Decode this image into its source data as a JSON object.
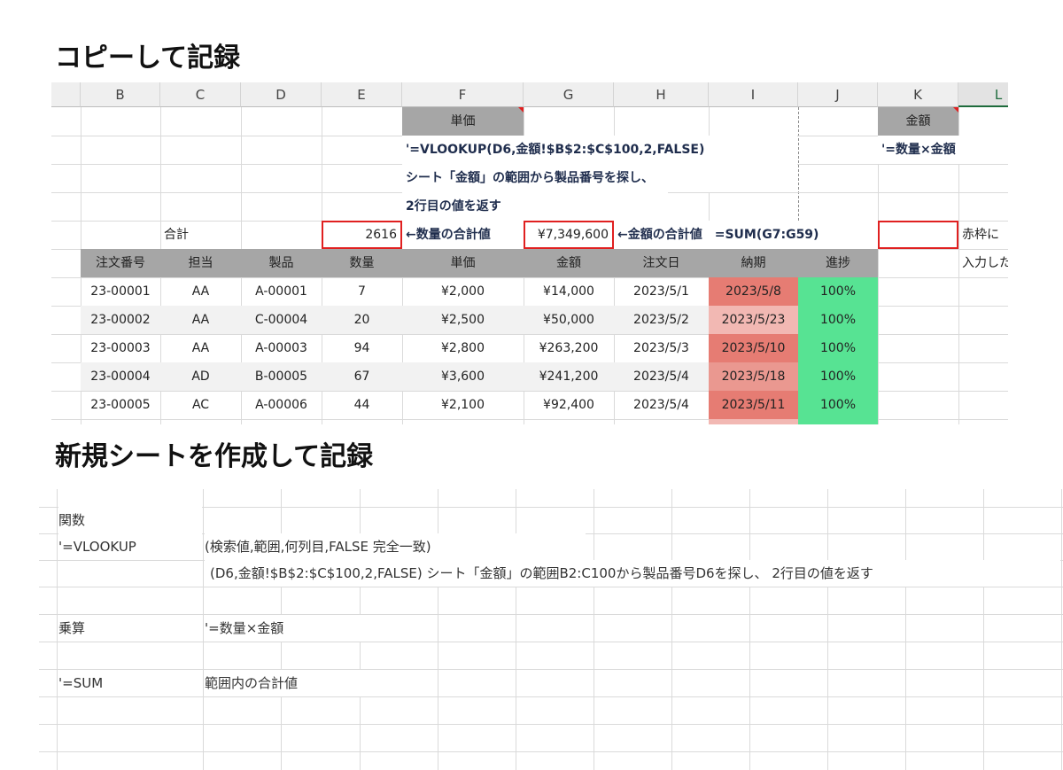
{
  "headings": {
    "copy_record": "コピーして記録",
    "new_sheet_record": "新規シートを作成して記録"
  },
  "sheet1": {
    "columns": [
      "B",
      "C",
      "D",
      "E",
      "F",
      "G",
      "H",
      "I",
      "J",
      "K",
      "L"
    ],
    "labels": {
      "unit_price_header": "単価",
      "amount_header": "金額",
      "vlookup_formula": "'=VLOOKUP(D6,金額!$B$2:$C$100,2,FALSE)",
      "multiply_formula": "'=数量×金額",
      "explain_line1": "シート「金額」の範囲から製品番号を探し、",
      "explain_line2": "2行目の値を返す",
      "total_label": "合計",
      "qty_total": "2616",
      "qty_note": "←数量の合計値",
      "amount_total": "¥7,349,600",
      "amount_note": "←金額の合計値　=SUM(G7:G59)",
      "red_frame_note": "赤枠に",
      "input_note": "入力した"
    },
    "table_headers": [
      "注文番号",
      "担当",
      "製品",
      "数量",
      "単価",
      "金額",
      "注文日",
      "納期",
      "進捗"
    ],
    "rows": [
      [
        "23-00001",
        "AA",
        "A-00001",
        "7",
        "¥2,000",
        "¥14,000",
        "2023/5/1",
        "2023/5/8",
        "100%"
      ],
      [
        "23-00002",
        "AA",
        "C-00004",
        "20",
        "¥2,500",
        "¥50,000",
        "2023/5/2",
        "2023/5/23",
        "100%"
      ],
      [
        "23-00003",
        "AA",
        "A-00003",
        "94",
        "¥2,800",
        "¥263,200",
        "2023/5/3",
        "2023/5/10",
        "100%"
      ],
      [
        "23-00004",
        "AD",
        "B-00005",
        "67",
        "¥3,600",
        "¥241,200",
        "2023/5/4",
        "2023/5/18",
        "100%"
      ],
      [
        "23-00005",
        "AC",
        "A-00006",
        "44",
        "¥2,100",
        "¥92,400",
        "2023/5/4",
        "2023/5/11",
        "100%"
      ]
    ],
    "colors": {
      "header_gray": "#a6a6a6",
      "red_border": "#e02020",
      "progress_green": "#57e393",
      "due_dark": "#e67c73",
      "due_light": "#f2b8b3"
    }
  },
  "sheet2": {
    "function_label": "関数",
    "vlookup_name": "'=VLOOKUP",
    "vlookup_args": "(検索値,範囲,何列目,FALSE 完全一致)",
    "vlookup_example": "(D6,金額!$B$2:$C$100,2,FALSE) シート「金額」の範囲B2:C100から製品番号D6を探し、 2行目の値を返す",
    "multiply_label": "乗算",
    "multiply_formula": "'=数量×金額",
    "sum_name": "'=SUM",
    "sum_desc": "範囲内の合計値"
  }
}
